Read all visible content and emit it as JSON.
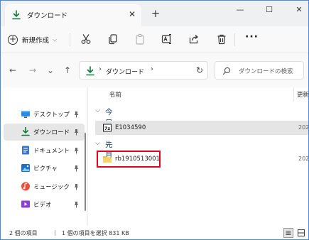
{
  "window": {
    "tab_title": "ダウンロード",
    "tab_close": "✕",
    "new_tab": "+",
    "controls": [
      "—",
      "☐",
      "✕"
    ]
  },
  "toolbar": {
    "new_label": "新規作成",
    "new_chevron": "⌵",
    "more": "···",
    "icons": [
      "cut-icon",
      "copy-icon",
      "paste-icon",
      "rename-icon",
      "share-icon",
      "delete-icon",
      "more-icon"
    ]
  },
  "nav": {
    "back": "←",
    "forward": "→",
    "recent": "⌄",
    "up": "↑",
    "address_sep": "›",
    "address": "ダウンロード",
    "refresh": "↻",
    "search_placeholder": "ダウンロードの検索"
  },
  "sidebar": {
    "items": [
      {
        "label": "デスクトップ",
        "icon": "desktop-icon"
      },
      {
        "label": "ダウンロード",
        "icon": "download-icon",
        "selected": true
      },
      {
        "label": "ドキュメント",
        "icon": "document-icon"
      },
      {
        "label": "ピクチャ",
        "icon": "picture-icon"
      },
      {
        "label": "ミュージック",
        "icon": "music-icon"
      },
      {
        "label": "ビデオ",
        "icon": "video-icon"
      }
    ]
  },
  "filelist": {
    "col_name": "名前",
    "col_date": "更新",
    "groups": [
      {
        "label": "今日",
        "chevron": "⌵",
        "files": [
          {
            "name": "E1034590",
            "date": "202",
            "icon": "7zip-icon",
            "selected": true
          }
        ]
      },
      {
        "label": "先月",
        "chevron": "⌵",
        "files": [
          {
            "name": "rb1910513001",
            "date": "202",
            "icon": "folder-icon",
            "selected": false
          }
        ]
      }
    ]
  },
  "status": {
    "count": "2 個の項目",
    "selection": "1 個の項目を選択  831 KB"
  },
  "colors": {
    "accent": "#0f7b3a",
    "folder": "#f2c04d",
    "highlight_box": "#e0001a",
    "window_border": "#4a8ad6"
  }
}
